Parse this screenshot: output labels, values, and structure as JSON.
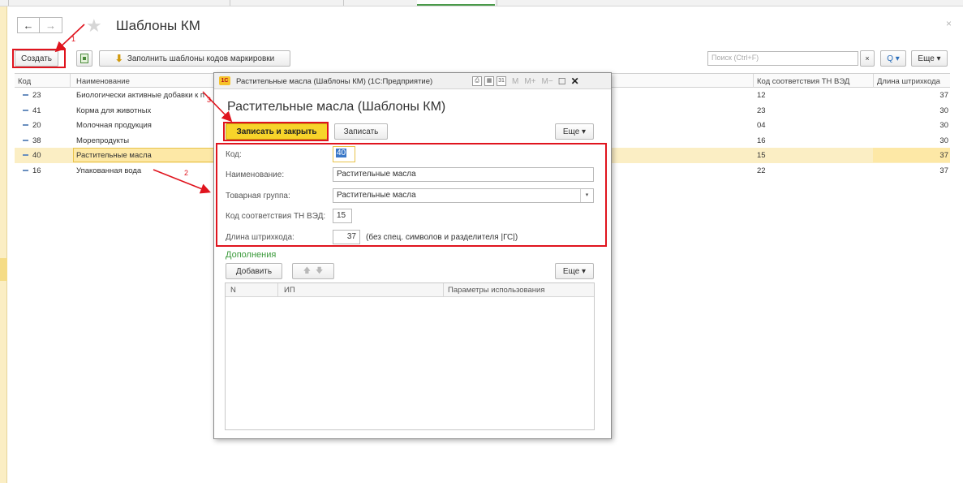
{
  "page": {
    "title": "Шаблоны КМ",
    "close_glyph": "×",
    "nav_back": "←",
    "nav_forward": "→",
    "star": "★"
  },
  "toolbar": {
    "create_label": "Создать",
    "fill_label": "Заполнить шаблоны кодов маркировки",
    "search_placeholder": "Поиск (Ctrl+F)",
    "clear_label": "×",
    "search_button_label": "Q ▾",
    "more_label": "Еще ▾"
  },
  "grid": {
    "columns": {
      "code": "Код",
      "name": "Наименование",
      "tnved": "Код соответствия ТН ВЭД",
      "barcode": "Длина штрихкода"
    },
    "rows": [
      {
        "code": "23",
        "name": "Биологически активные добавки к п",
        "tnved": "12",
        "barcode": "37"
      },
      {
        "code": "41",
        "name": "Корма для животных",
        "tnved": "23",
        "barcode": "30"
      },
      {
        "code": "20",
        "name": "Молочная продукция",
        "tnved": "04",
        "barcode": "30"
      },
      {
        "code": "38",
        "name": "Морепродукты",
        "tnved": "16",
        "barcode": "30"
      },
      {
        "code": "40",
        "name": "Растительные масла",
        "tnved": "15",
        "barcode": "37"
      },
      {
        "code": "16",
        "name": "Упакованная вода",
        "tnved": "22",
        "barcode": "37"
      }
    ]
  },
  "dialog": {
    "window_title": "Растительные масла (Шаблоны КМ)  (1С:Предприятие)",
    "logo": "1С",
    "tools": {
      "print": "⎙",
      "calc": "▦",
      "calendar": "31",
      "m": "M",
      "mplus": "M+",
      "mminus": "M−",
      "maximize": "☐",
      "close": "✕"
    },
    "heading": "Растительные масла (Шаблоны КМ)",
    "save_close_label": "Записать и закрыть",
    "save_label": "Записать",
    "more_label": "Еще ▾",
    "fields": {
      "code_label": "Код:",
      "code_value": "40",
      "name_label": "Наименование:",
      "name_value": "Растительные масла",
      "group_label": "Товарная группа:",
      "group_value": "Растительные масла",
      "tnved_label": "Код соответствия ТН ВЭД:",
      "tnved_value": "15",
      "barcode_label": "Длина штрихкода:",
      "barcode_value": "37",
      "barcode_note": "(без спец. символов и разделителя |ГС|)"
    },
    "additions": {
      "title": "Дополнения",
      "add_label": "Добавить",
      "up": "🡅",
      "down": "🡇",
      "more_label": "Еще ▾",
      "columns": {
        "n": "N",
        "ip": "ИП",
        "params": "Параметры использования"
      }
    }
  },
  "annotations": {
    "one": "1",
    "two": "2",
    "three": "3"
  },
  "colors": {
    "annotation": "#e0141e",
    "primary_button": "#f7d42a",
    "selection": "#fbeec4",
    "section_title": "#3a9a3a"
  }
}
